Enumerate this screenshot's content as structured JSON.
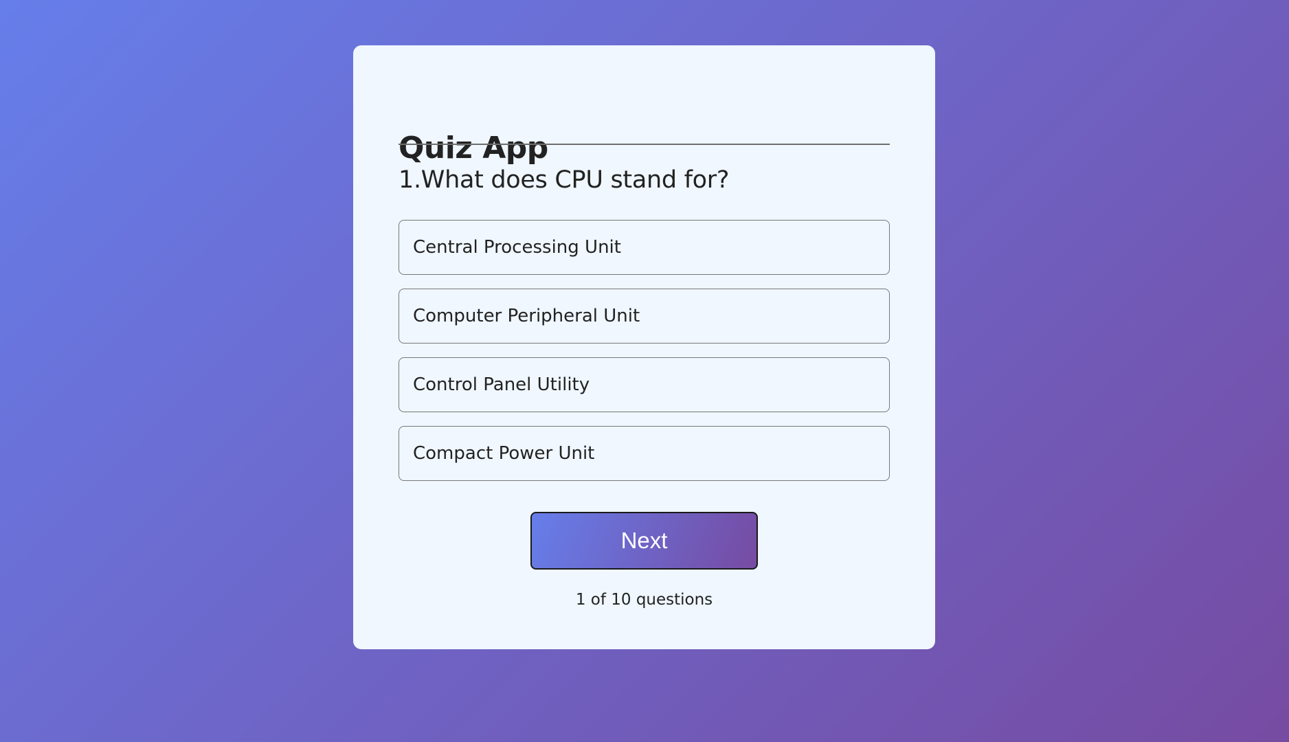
{
  "app": {
    "title": "Quiz App"
  },
  "quiz": {
    "question": "1.What does CPU stand for?",
    "options": [
      {
        "label": "Central Processing Unit"
      },
      {
        "label": "Computer Peripheral Unit"
      },
      {
        "label": "Control Panel Utility"
      },
      {
        "label": "Compact Power Unit"
      }
    ],
    "next_label": "Next",
    "progress": "1 of 10 questions"
  },
  "colors": {
    "gradient_start": "#667eea",
    "gradient_end": "#764ba2",
    "card_background": "#f0f7ff"
  }
}
